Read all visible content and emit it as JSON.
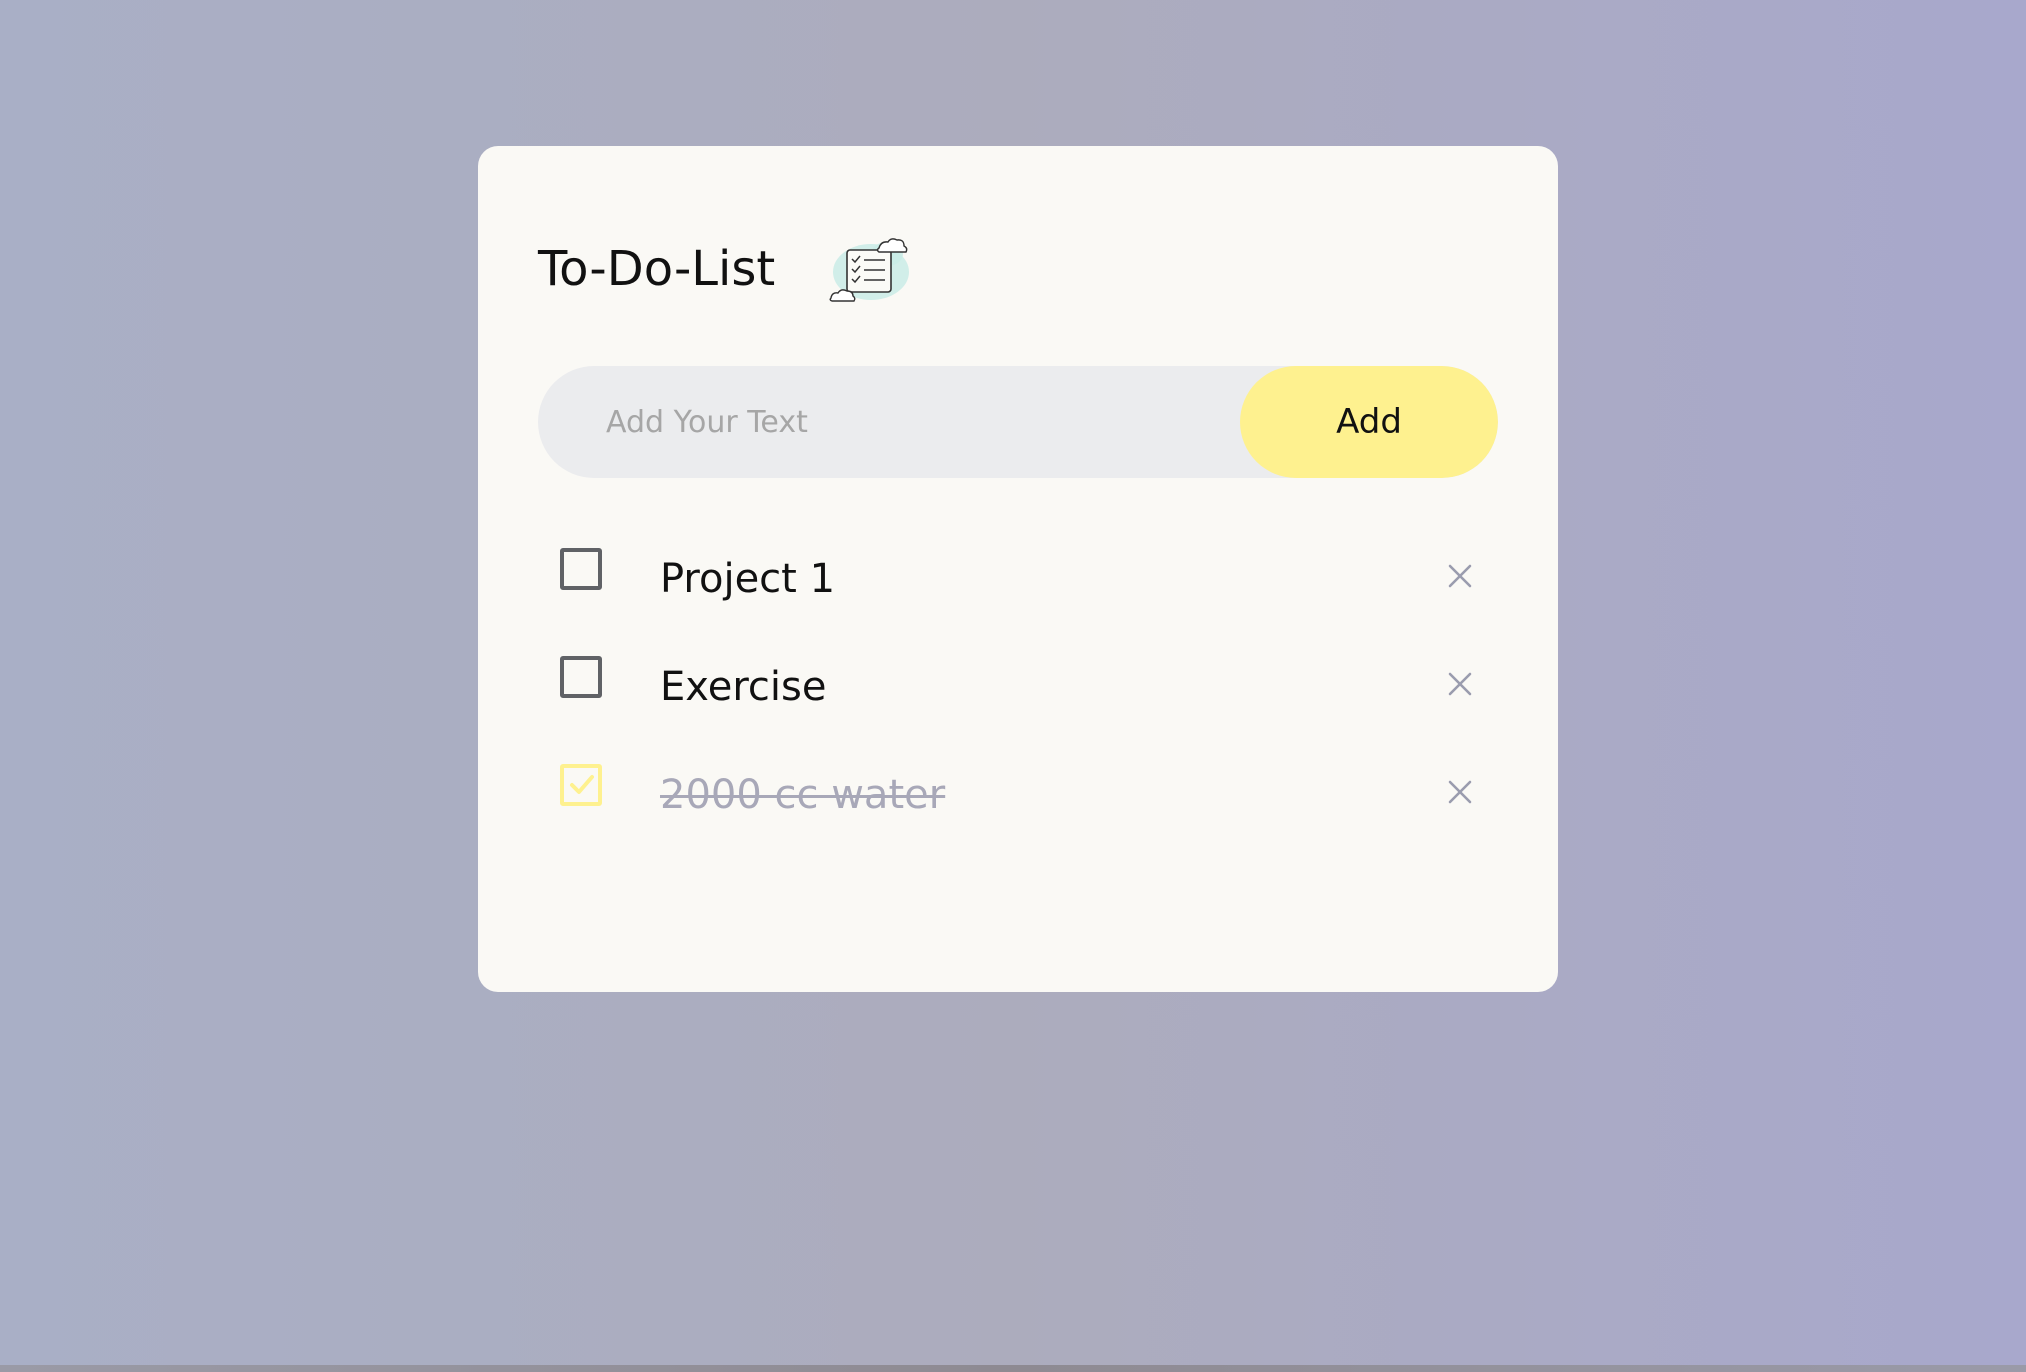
{
  "app": {
    "title": "To-Do-List",
    "title_icon": "checklist-clouds-icon"
  },
  "input": {
    "placeholder": "Add Your Text",
    "value": "",
    "add_label": "Add"
  },
  "tasks": [
    {
      "text": "Project 1",
      "completed": false
    },
    {
      "text": "Exercise",
      "completed": false
    },
    {
      "text": "2000 cc water",
      "completed": true
    }
  ],
  "colors": {
    "accent": "#fef18f",
    "card": "#faf9f5",
    "input_bg": "#ebecee",
    "checkbox_border": "#606266",
    "done_text": "#a8a8b8",
    "delete_icon": "#9a9cae"
  },
  "icons": {
    "delete": "close-icon",
    "checked": "checkmark-icon",
    "unchecked": "empty-checkbox-icon"
  }
}
